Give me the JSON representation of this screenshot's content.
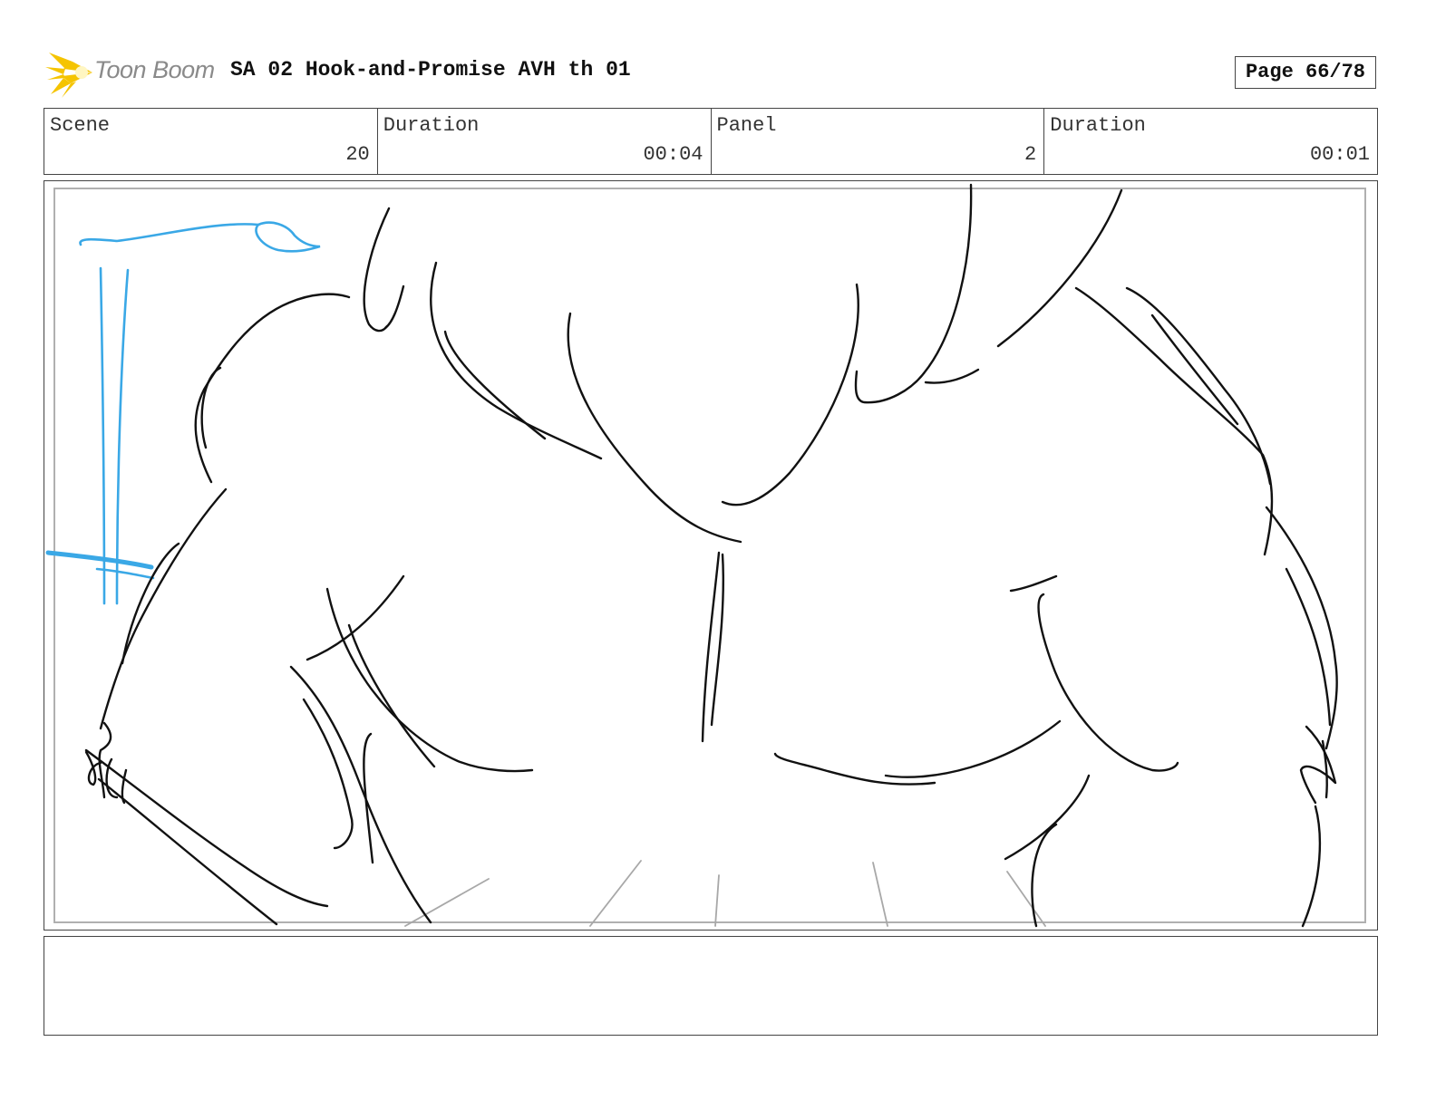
{
  "header": {
    "logo_text": "Toon Boom",
    "title": "SA 02 Hook-and-Promise AVH th 01",
    "page": "Page 66/78"
  },
  "info": {
    "scene_label": "Scene",
    "scene_value": "20",
    "scene_duration_label": "Duration",
    "scene_duration_value": "00:04",
    "panel_label": "Panel",
    "panel_value": "2",
    "panel_duration_label": "Duration",
    "panel_duration_value": "00:01"
  },
  "notes": {
    "text": ""
  },
  "colors": {
    "sketch_line": "#111111",
    "blue_line": "#3aa8e6",
    "construction_line": "#a8a8a8",
    "logo_yellow": "#f5c400"
  },
  "icons": {
    "logo": "toon-boom-burst-icon"
  }
}
